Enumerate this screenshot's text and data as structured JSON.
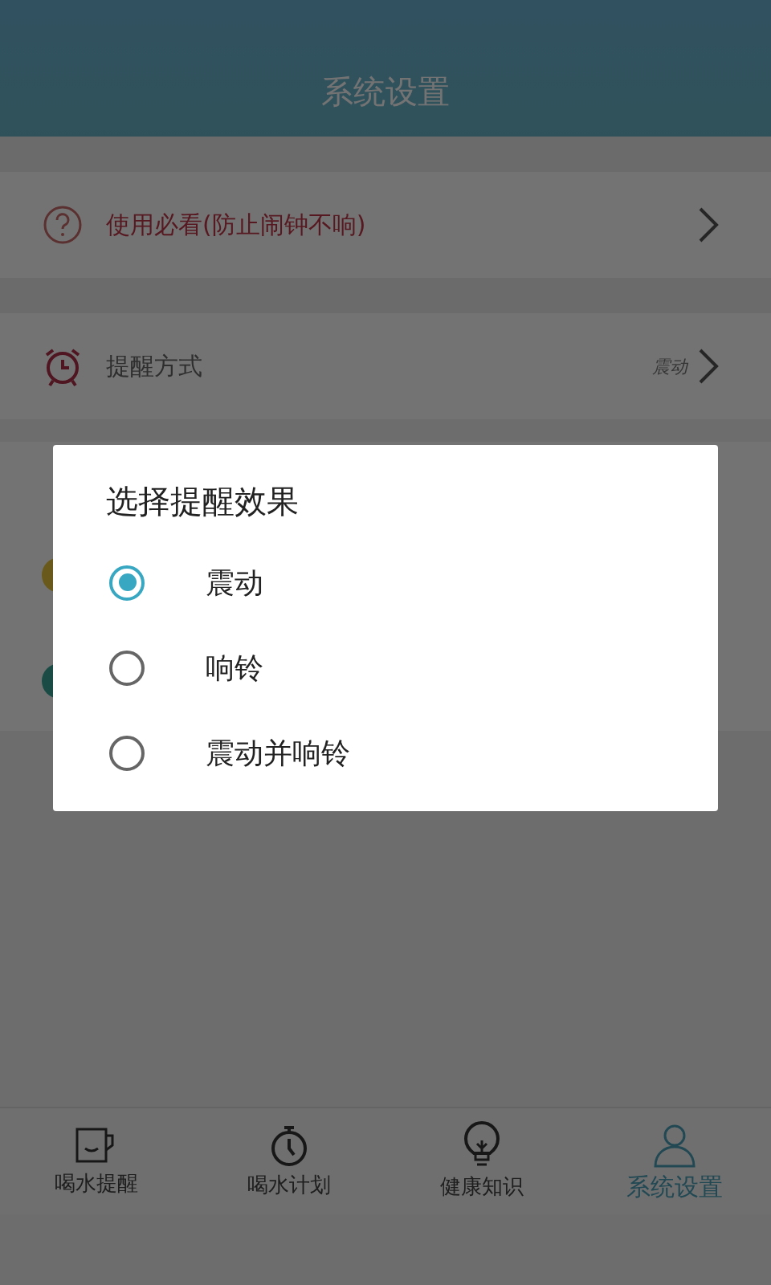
{
  "header": {
    "title": "系统设置"
  },
  "rows": [
    {
      "kind": "help",
      "label": "使用必看(防止闹钟不响)",
      "value": null
    },
    {
      "kind": "alarm",
      "label": "提醒方式",
      "value": "震动"
    }
  ],
  "dialog": {
    "title": "选择提醒效果",
    "options": [
      {
        "label": "震动",
        "selected": true
      },
      {
        "label": "响铃",
        "selected": false
      },
      {
        "label": "震动并响铃",
        "selected": false
      }
    ]
  },
  "tabs": [
    {
      "kind": "cup",
      "label": "喝水提醒",
      "selected": false
    },
    {
      "kind": "timer",
      "label": "喝水计划",
      "selected": false
    },
    {
      "kind": "bulb",
      "label": "健康知识",
      "selected": false
    },
    {
      "kind": "person",
      "label": "系统设置",
      "selected": true
    }
  ]
}
